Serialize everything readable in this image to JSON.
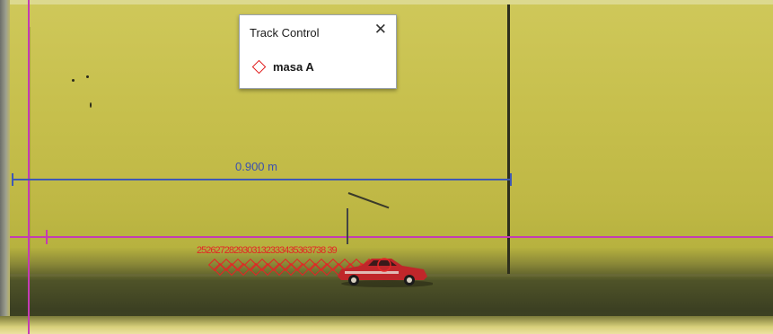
{
  "track_control": {
    "title": "Track Control",
    "close_icon": "close-icon",
    "tracks": [
      {
        "label": "masa A",
        "icon": "diamond-icon",
        "color": "#e01a1a"
      }
    ]
  },
  "calibration": {
    "length_label": "0.900 m",
    "color": "#3e58b5"
  },
  "axes": {
    "color": "#c43cb4"
  },
  "track_points": {
    "frame_labels": "2526272829303132333435363738 39",
    "marker_count": 15,
    "color": "#e32626"
  }
}
